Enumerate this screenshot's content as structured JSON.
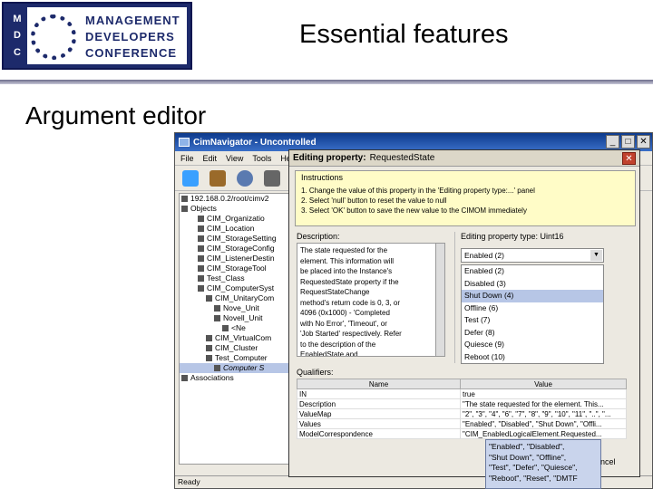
{
  "slide": {
    "logo": {
      "letters": [
        "M",
        "D",
        "C"
      ],
      "lines": [
        "MANAGEMENT",
        "DEVELOPERS",
        "CONFERENCE"
      ]
    },
    "title": "Essential features",
    "section": "Argument editor"
  },
  "app": {
    "title": "CimNavigator - Uncontrolled",
    "menu": [
      "File",
      "Edit",
      "View",
      "Tools",
      "He"
    ],
    "tree": [
      {
        "label": "192.168.0.2/root/cimv2",
        "indent": 0
      },
      {
        "label": "Objects",
        "indent": 0
      },
      {
        "label": "CIM_Organizatio",
        "indent": 2
      },
      {
        "label": "CIM_Location",
        "indent": 2
      },
      {
        "label": "CIM_StorageSetting",
        "indent": 2
      },
      {
        "label": "CIM_StorageConfig",
        "indent": 2
      },
      {
        "label": "CIM_ListenerDestin",
        "indent": 2
      },
      {
        "label": "CIM_StorageTool",
        "indent": 2
      },
      {
        "label": "Test_Class",
        "indent": 2
      },
      {
        "label": "CIM_ComputerSyst",
        "indent": 2
      },
      {
        "label": "CIM_UnitaryCom",
        "indent": 3
      },
      {
        "label": "Nove_Unit",
        "indent": 4
      },
      {
        "label": "Novell_Unit",
        "indent": 4
      },
      {
        "label": "<Ne",
        "indent": 5
      },
      {
        "label": "CIM_VirtualCom",
        "indent": 3
      },
      {
        "label": "CIM_Cluster",
        "indent": 3
      },
      {
        "label": "Test_Computer",
        "indent": 3
      },
      {
        "label": "Computer S",
        "indent": 4,
        "selected": true
      },
      {
        "label": "Associations",
        "indent": 0
      }
    ],
    "status": "Ready"
  },
  "dialog": {
    "title_bold": "Editing property:",
    "title_rest": "RequestedState",
    "instructions_header": "Instructions",
    "instructions": [
      "1. Change the value of this property in the 'Editing property type:...' panel",
      "2. Select 'null' button to reset the value to null",
      "3. Select 'OK' button to save the new value to the CIMOM immediately"
    ],
    "description_label": "Description:",
    "description_lines": [
      "The state requested for the",
      "element. This information will",
      "be placed into the Instance's",
      "RequestedState property if the",
      "RequestStateChange",
      "method's return code is 0, 3, or",
      "4096 (0x1000) - 'Completed",
      "with No Error', 'Timeout', or",
      "'Job Started' respectively. Refer",
      "to the description of the",
      "EnabledState and"
    ],
    "edit_label": "Editing property type: Uint16",
    "selected_value": "Enabled (2)",
    "options": [
      {
        "label": "Enabled (2)"
      },
      {
        "label": "Disabled (3)"
      },
      {
        "label": "Shut Down (4)",
        "selected": true
      },
      {
        "label": "Offline (6)"
      },
      {
        "label": "Test (7)"
      },
      {
        "label": "Defer (8)"
      },
      {
        "label": "Quiesce (9)"
      },
      {
        "label": "Reboot (10)"
      }
    ],
    "qualifiers_label": "Qualifiers:",
    "columns": [
      "Name",
      "Value"
    ],
    "rows": [
      [
        "IN",
        "true"
      ],
      [
        "Description",
        "\"The state requested for the element. This..."
      ],
      [
        "ValueMap",
        "\"2\", \"3\", \"4\", \"6\", \"7\", \"8\", \"9\", \"10\", \"11\", \"..\", \"..."
      ],
      [
        "Values",
        "\"Enabled\", \"Disabled\", \"Shut Down\", \"Offli..."
      ],
      [
        "ModelCorrespondence",
        "\"CIM_EnabledLogicalElement.Requested..."
      ]
    ],
    "cancel_fragment": "ncel"
  },
  "tooltip": {
    "lines": [
      "\"Enabled\", \"Disabled\",",
      "\"Shut Down\", \"Offline\",",
      "\"Test\", \"Defer\", \"Quiesce\",",
      "\"Reboot\", \"Reset\", \"DMTF"
    ]
  }
}
